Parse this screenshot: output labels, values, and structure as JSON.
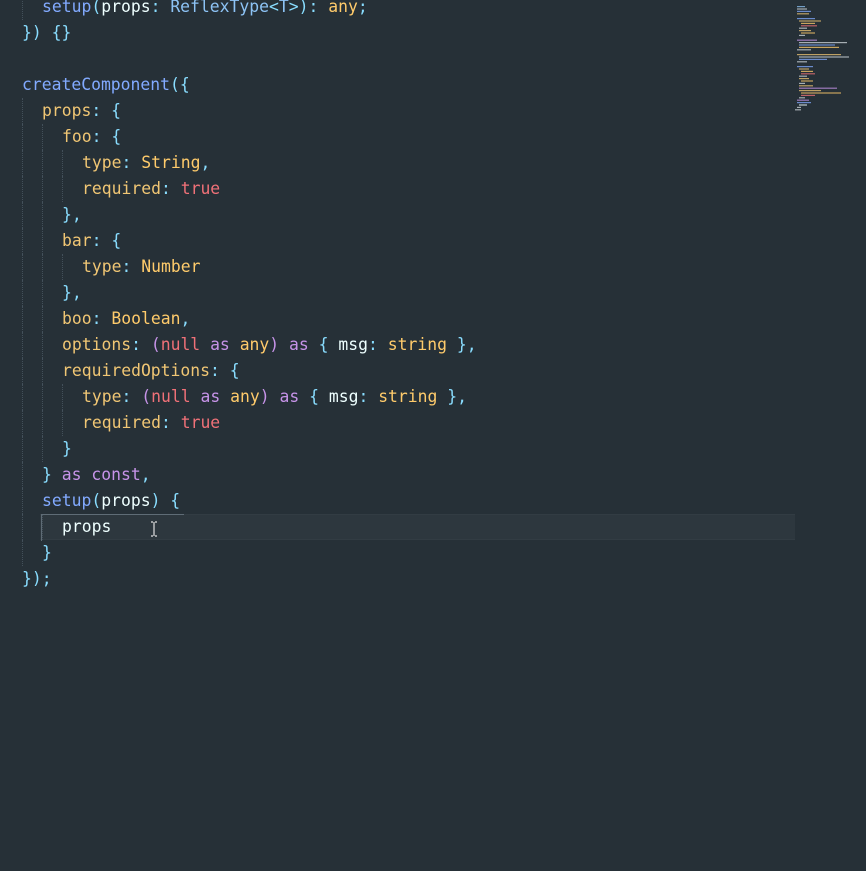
{
  "editor": {
    "language": "typescript",
    "current_line_index": 20,
    "lines": [
      [
        [
          1,
          ""
        ],
        [
          [
            "t-fn",
            "setup"
          ],
          [
            "t-pn",
            "("
          ],
          [
            "t-id",
            "props"
          ],
          [
            "t-pn",
            ": "
          ],
          [
            "t-gen",
            "ReflexType"
          ],
          [
            "t-pn",
            "<"
          ],
          [
            "t-gen",
            "T"
          ],
          [
            "t-pn",
            ">"
          ],
          [
            "t-pn",
            "): "
          ],
          [
            "t-type",
            "any"
          ],
          [
            "t-pn",
            ";"
          ]
        ]
      ],
      [
        [
          0,
          ""
        ],
        [
          [
            "t-pn",
            "}) {}"
          ]
        ]
      ],
      [
        [
          0,
          ""
        ],
        []
      ],
      [
        [
          0,
          ""
        ],
        [
          [
            "t-fn",
            "createComponent"
          ],
          [
            "t-pn",
            "({"
          ]
        ]
      ],
      [
        [
          1,
          ""
        ],
        [
          [
            "t-prop",
            "props"
          ],
          [
            "t-pn",
            ": {"
          ]
        ]
      ],
      [
        [
          2,
          ""
        ],
        [
          [
            "t-prop",
            "foo"
          ],
          [
            "t-pn",
            ": {"
          ]
        ]
      ],
      [
        [
          3,
          ""
        ],
        [
          [
            "t-prop",
            "type"
          ],
          [
            "t-pn",
            ": "
          ],
          [
            "t-type",
            "String"
          ],
          [
            "t-pn",
            ","
          ]
        ]
      ],
      [
        [
          3,
          ""
        ],
        [
          [
            "t-prop",
            "required"
          ],
          [
            "t-pn",
            ": "
          ],
          [
            "t-bool",
            "true"
          ]
        ]
      ],
      [
        [
          2,
          ""
        ],
        [
          [
            "t-pn",
            "},"
          ]
        ]
      ],
      [
        [
          2,
          ""
        ],
        [
          [
            "t-prop",
            "bar"
          ],
          [
            "t-pn",
            ": {"
          ]
        ]
      ],
      [
        [
          3,
          ""
        ],
        [
          [
            "t-prop",
            "type"
          ],
          [
            "t-pn",
            ": "
          ],
          [
            "t-type",
            "Number"
          ]
        ]
      ],
      [
        [
          2,
          ""
        ],
        [
          [
            "t-pn",
            "},"
          ]
        ]
      ],
      [
        [
          2,
          ""
        ],
        [
          [
            "t-prop",
            "boo"
          ],
          [
            "t-pn",
            ": "
          ],
          [
            "t-type",
            "Boolean"
          ],
          [
            "t-pn",
            ","
          ]
        ]
      ],
      [
        [
          2,
          ""
        ],
        [
          [
            "t-prop",
            "options"
          ],
          [
            "t-pn",
            ": "
          ],
          [
            "t-kw",
            "("
          ],
          [
            "t-bool",
            "null"
          ],
          [
            "t-plain",
            " "
          ],
          [
            "t-kw",
            "as"
          ],
          [
            "t-plain",
            " "
          ],
          [
            "t-type",
            "any"
          ],
          [
            "t-kw",
            ")"
          ],
          [
            "t-plain",
            " "
          ],
          [
            "t-kw",
            "as"
          ],
          [
            "t-plain",
            " "
          ],
          [
            "t-pn",
            "{ "
          ],
          [
            "t-id",
            "msg"
          ],
          [
            "t-pn",
            ": "
          ],
          [
            "t-type",
            "string"
          ],
          [
            "t-pn",
            " },"
          ]
        ]
      ],
      [
        [
          2,
          ""
        ],
        [
          [
            "t-prop",
            "requiredOptions"
          ],
          [
            "t-pn",
            ": {"
          ]
        ]
      ],
      [
        [
          3,
          ""
        ],
        [
          [
            "t-prop",
            "type"
          ],
          [
            "t-pn",
            ": "
          ],
          [
            "t-kw",
            "("
          ],
          [
            "t-bool",
            "null"
          ],
          [
            "t-plain",
            " "
          ],
          [
            "t-kw",
            "as"
          ],
          [
            "t-plain",
            " "
          ],
          [
            "t-type",
            "any"
          ],
          [
            "t-kw",
            ")"
          ],
          [
            "t-plain",
            " "
          ],
          [
            "t-kw",
            "as"
          ],
          [
            "t-plain",
            " "
          ],
          [
            "t-pn",
            "{ "
          ],
          [
            "t-id",
            "msg"
          ],
          [
            "t-pn",
            ": "
          ],
          [
            "t-type",
            "string"
          ],
          [
            "t-pn",
            " },"
          ]
        ]
      ],
      [
        [
          3,
          ""
        ],
        [
          [
            "t-prop",
            "required"
          ],
          [
            "t-pn",
            ": "
          ],
          [
            "t-bool",
            "true"
          ]
        ]
      ],
      [
        [
          2,
          ""
        ],
        [
          [
            "t-pn",
            "}"
          ]
        ]
      ],
      [
        [
          1,
          ""
        ],
        [
          [
            "t-pn",
            "} "
          ],
          [
            "t-kw",
            "as"
          ],
          [
            "t-plain",
            " "
          ],
          [
            "t-kw",
            "const"
          ],
          [
            "t-pn",
            ","
          ]
        ]
      ],
      [
        [
          1,
          ""
        ],
        [
          [
            "t-fn",
            "setup"
          ],
          [
            "t-pn",
            "("
          ],
          [
            "t-id",
            "props"
          ],
          [
            "t-pn",
            ") {"
          ]
        ]
      ],
      [
        [
          2,
          ""
        ],
        [
          [
            "t-id",
            "props"
          ]
        ]
      ],
      [
        [
          1,
          ""
        ],
        [
          [
            "t-pn",
            "}"
          ]
        ]
      ],
      [
        [
          0,
          ""
        ],
        [
          [
            "t-pn",
            "});"
          ]
        ]
      ]
    ]
  },
  "colors": {
    "background": "#263037",
    "current_line": "#2d373e",
    "indent_guide": "#43505a"
  },
  "icons": {
    "text_cursor": "ibeam-cursor-icon",
    "minimap": "minimap-overview"
  }
}
